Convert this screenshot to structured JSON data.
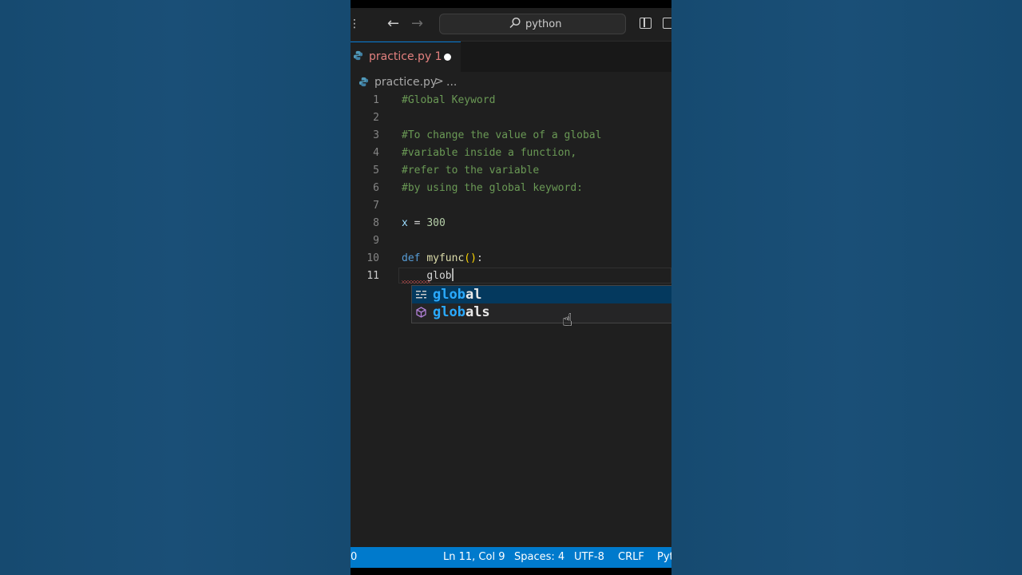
{
  "titlebar": {
    "search_text": "python"
  },
  "tab": {
    "label": "practice.py 1",
    "modified": true
  },
  "breadcrumb": {
    "file": "practice.py",
    "separator": ">",
    "more": "..."
  },
  "editor": {
    "lines": [
      {
        "number": "1",
        "text": "#Global Keyword"
      },
      {
        "number": "2",
        "text": ""
      },
      {
        "number": "3",
        "text": "#To change the value of a global"
      },
      {
        "number": "4",
        "text": "#variable inside a function,"
      },
      {
        "number": "5",
        "text": "#refer to the variable"
      },
      {
        "number": "6",
        "text": "#by using the global keyword:"
      },
      {
        "number": "7",
        "text": ""
      },
      {
        "number": "8",
        "text": "x = 300"
      },
      {
        "number": "9",
        "text": ""
      },
      {
        "number": "10",
        "text": "def myfunc():"
      },
      {
        "number": "11",
        "text": "    glob"
      }
    ],
    "tokens": {
      "l8_var": "x",
      "l8_op": " = ",
      "l8_num": "300",
      "l10_kw": "def",
      "l10_fn": "myfunc",
      "l10_paren": "()",
      "l10_colon": ":",
      "l11_text": "glob"
    }
  },
  "suggestions": [
    {
      "match": "glob",
      "rest": "al",
      "icon": "keyword-icon",
      "selected": true
    },
    {
      "match": "glob",
      "rest": "als",
      "icon": "cube-icon",
      "selected": false
    }
  ],
  "statusbar": {
    "errors": "0",
    "position": "Ln 11, Col 9",
    "spaces": "Spaces: 4",
    "encoding": "UTF-8",
    "eol": "CRLF",
    "language": "Pyt"
  },
  "colors": {
    "statusbar": "#007acc",
    "comment": "#6a9955",
    "keyword": "#569cd6",
    "suggest_selected": "#04395e",
    "match_highlight": "#2aaaff"
  }
}
